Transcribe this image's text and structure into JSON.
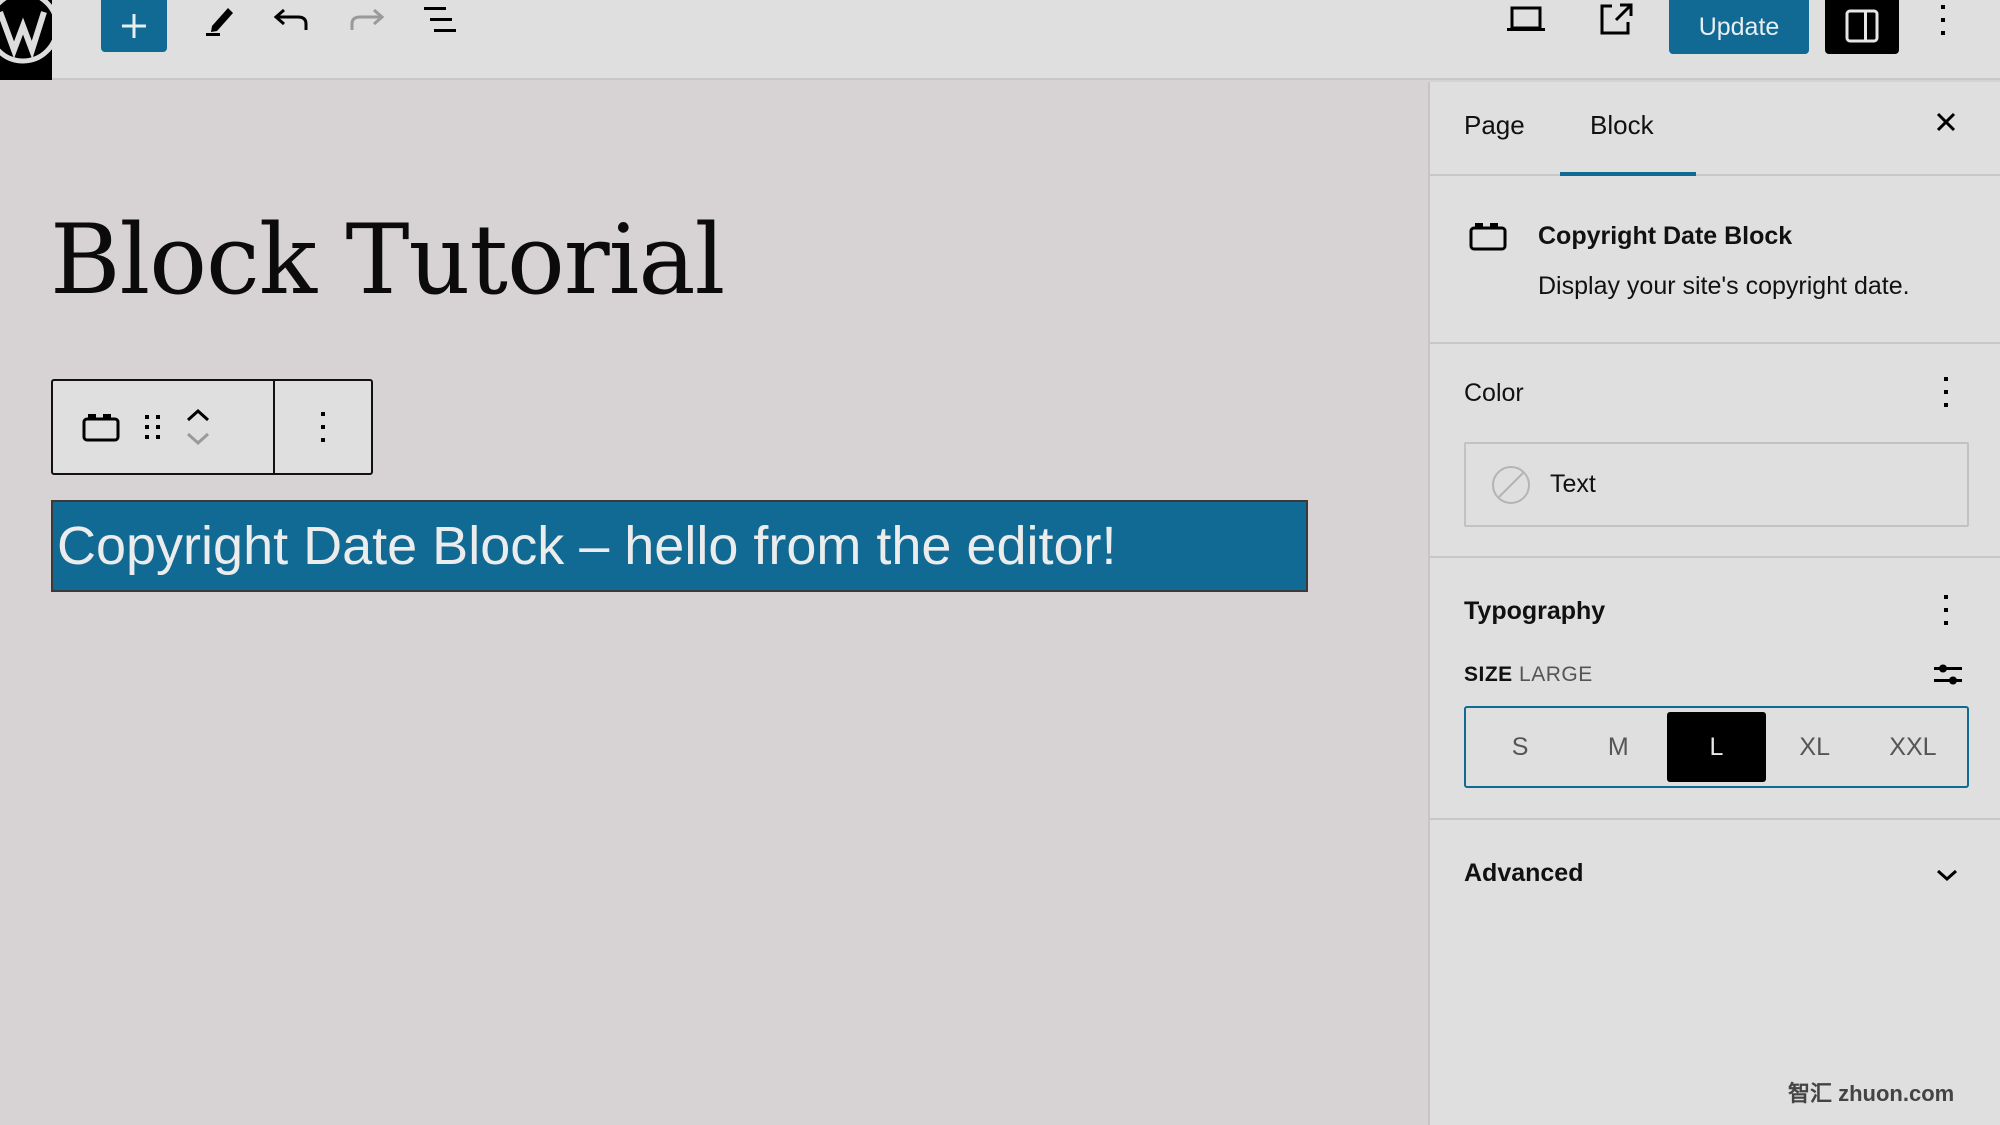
{
  "header": {
    "logo": "wordpress-logo",
    "add_block_icon": "plus-icon",
    "tools_icon": "pencil-icon",
    "undo_icon": "undo-icon",
    "redo_icon": "redo-icon",
    "list_view_icon": "list-view-icon",
    "preview_icon": "laptop-icon",
    "view_post_icon": "external-link-icon",
    "update_label": "Update",
    "settings_icon": "sidebar-toggle-icon",
    "options_icon": "more-vertical-icon",
    "colors": {
      "accent": "#116a94",
      "dark": "#000000"
    }
  },
  "canvas": {
    "post_title": "Block Tutorial",
    "block_toolbar": {
      "block_icon": "block-icon",
      "drag_icon": "drag-handle-icon",
      "move_up_icon": "chevron-up-icon",
      "move_down_icon": "chevron-down-icon",
      "options_icon": "more-vertical-icon"
    },
    "selected_block_text": "Copyright Date Block – hello from the editor!",
    "selected_block_bg": "#116a94"
  },
  "sidebar": {
    "tabs": [
      {
        "label": "Page",
        "active": false
      },
      {
        "label": "Block",
        "active": true
      }
    ],
    "close_icon": "close-icon",
    "block_card": {
      "title": "Copyright Date Block",
      "description": "Display your site's copyright date."
    },
    "color_panel": {
      "title": "Color",
      "items": [
        {
          "label": "Text",
          "swatch": "none"
        }
      ]
    },
    "typography_panel": {
      "title": "Typography",
      "size_key": "SIZE",
      "size_value": "LARGE",
      "sizes": [
        "S",
        "M",
        "L",
        "XL",
        "XXL"
      ],
      "selected_size": "L"
    },
    "advanced_panel": {
      "title": "Advanced",
      "expanded": false
    }
  },
  "watermark": "智汇 zhuon.com"
}
